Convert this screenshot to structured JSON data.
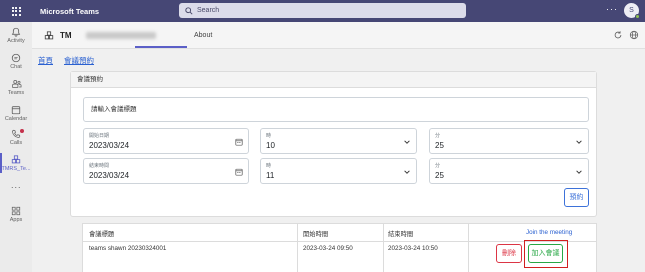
{
  "topbar": {
    "app_title": "Microsoft Teams",
    "search_placeholder": "Search",
    "more": "···",
    "avatar_initial": "S",
    "bg_color": "#464775"
  },
  "rail": {
    "items": [
      {
        "label": "Activity",
        "icon": "bell-icon"
      },
      {
        "label": "Chat",
        "icon": "chat-icon"
      },
      {
        "label": "Teams",
        "icon": "teams-icon"
      },
      {
        "label": "Calendar",
        "icon": "calendar-icon"
      },
      {
        "label": "Calls",
        "icon": "phone-icon"
      },
      {
        "label": "TMRS_Te...",
        "icon": "app-icon"
      },
      {
        "label": "···",
        "icon": "more-icon"
      },
      {
        "label": "Apps",
        "icon": "apps-icon"
      }
    ]
  },
  "app_header": {
    "name": "TM",
    "about_tab": "About"
  },
  "breadcrumb": {
    "home": "首頁",
    "booking": "會議預約"
  },
  "booking_panel": {
    "header": "會議預約",
    "title_placeholder": "請輸入會議標題",
    "start_date_label": "開始日期",
    "start_date": "2023/03/24",
    "start_hour_label": "時",
    "start_hour": "10",
    "start_min_label": "分",
    "start_min": "25",
    "end_date_label": "結束時間",
    "end_date": "2023/03/24",
    "end_hour_label": "時",
    "end_hour": "11",
    "end_min_label": "分",
    "end_min": "25",
    "submit": "預約"
  },
  "table": {
    "headers": [
      "會議標題",
      "開始時間",
      "結束時間",
      "Join the meeting"
    ],
    "rows": [
      {
        "title": "teams shawn 20230324001",
        "start": "2023-03-24 09:50",
        "end": "2023-03-24 10:50",
        "delete_label": "刪除",
        "join_label": "加入會議"
      }
    ]
  }
}
